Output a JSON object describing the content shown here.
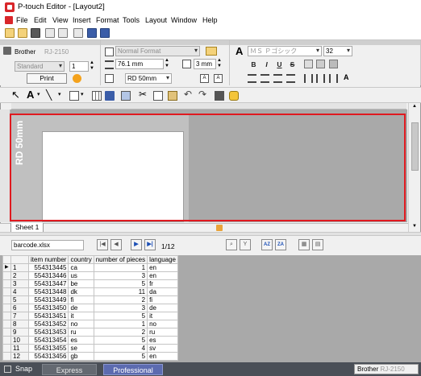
{
  "window": {
    "title": "P-touch Editor - [Layout2]"
  },
  "menu": [
    "File",
    "Edit",
    "View",
    "Insert",
    "Format",
    "Tools",
    "Layout",
    "Window",
    "Help"
  ],
  "printer_panel": {
    "printer_name": "Brother",
    "printer_model": "RJ-2150",
    "quality": "Standard",
    "copies": "1",
    "print_label": "Print"
  },
  "paper_panel": {
    "format": "Normal Format",
    "length": "76.1 mm",
    "margin": "3 mm",
    "media": "RD 50mm"
  },
  "font_panel": {
    "font_name": "ＭＳ Ｐゴシック",
    "font_size": "32",
    "bold": "B",
    "italic": "I",
    "underline": "U",
    "strike": "S"
  },
  "canvas": {
    "media_label": "RD 50mm",
    "sheet_tab": "Sheet 1"
  },
  "database": {
    "file": "barcode.xlsx",
    "record": "1/12",
    "columns": [
      "item number",
      "country",
      "number of pieces",
      "language"
    ],
    "rows": [
      [
        "554313445",
        "ca",
        "1",
        "en"
      ],
      [
        "554313446",
        "us",
        "3",
        "en"
      ],
      [
        "554313447",
        "be",
        "5",
        "fr"
      ],
      [
        "554313448",
        "dk",
        "11",
        "da"
      ],
      [
        "554313449",
        "fi",
        "2",
        "fi"
      ],
      [
        "554313450",
        "de",
        "3",
        "de"
      ],
      [
        "554313451",
        "it",
        "5",
        "it"
      ],
      [
        "554313452",
        "no",
        "1",
        "no"
      ],
      [
        "554313453",
        "ru",
        "2",
        "ru"
      ],
      [
        "554313454",
        "es",
        "5",
        "es"
      ],
      [
        "554313455",
        "se",
        "4",
        "sv"
      ],
      [
        "554313456",
        "gb",
        "5",
        "en"
      ]
    ],
    "row_numbers": [
      "1",
      "2",
      "3",
      "4",
      "5",
      "6",
      "7",
      "8",
      "9",
      "10",
      "11",
      "12"
    ]
  },
  "statusbar": {
    "snap": "Snap",
    "express": "Express",
    "professional": "Professional",
    "printer_name": "Brother",
    "printer_model": "RJ-2150"
  },
  "colors": {
    "accent": "#5c6bb0",
    "highlight": "#e0191f",
    "canvas": "#a9a9a9"
  }
}
